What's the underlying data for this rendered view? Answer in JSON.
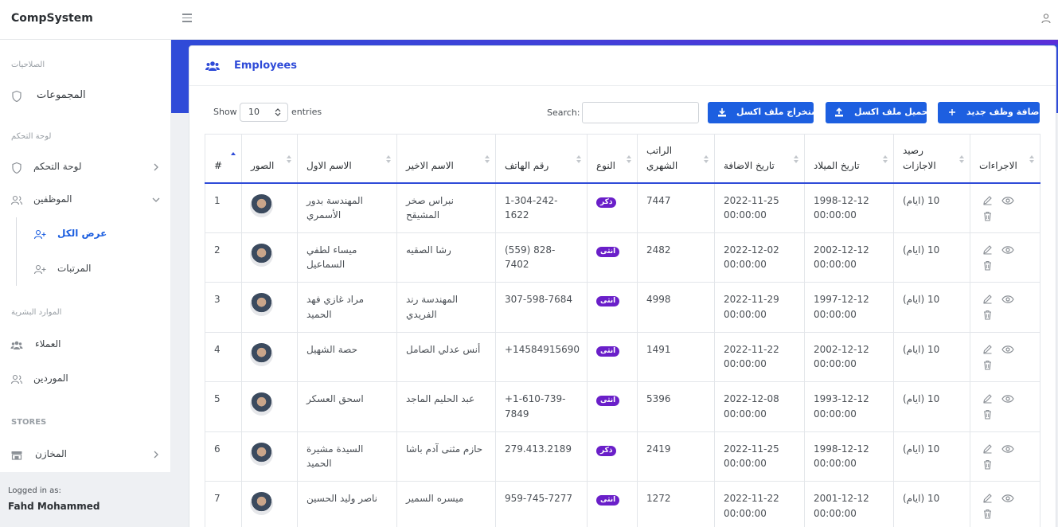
{
  "app": {
    "brand": "CompSystem"
  },
  "sidebar": {
    "sections": [
      {
        "title": "الصلاحيات"
      },
      {
        "title": "لوحة التحكم"
      },
      {
        "title": "الموارد البشرية"
      },
      {
        "title": "STORES"
      }
    ],
    "items": [
      {
        "label": "المجموعات",
        "icon": "shield-icon"
      },
      {
        "label": "لوحة التحكم",
        "icon": "shield-icon"
      },
      {
        "label": "الموظفين",
        "icon": "users-icon"
      },
      {
        "label": "عرض الكل",
        "icon": "user-plus-icon",
        "active": true
      },
      {
        "label": "المرتبات",
        "icon": "user-plus-icon"
      },
      {
        "label": "العملاء",
        "icon": "users-icon"
      },
      {
        "label": "الموردين",
        "icon": "users-icon"
      },
      {
        "label": "المخازن",
        "icon": "store-icon"
      }
    ],
    "footer": {
      "logged_in_label": "Logged in as:",
      "user_name": "Fahd Mohammed"
    }
  },
  "card": {
    "title": "Employees"
  },
  "table_controls": {
    "show_label": "Show",
    "page_length": "10",
    "entries_label": "entries",
    "search_label": "Search:",
    "search_value": ""
  },
  "buttons": {
    "add": "اضافة وظف جديد",
    "import": "تحميل ملف اكسل",
    "export": "استخراج ملف اكسل"
  },
  "table": {
    "columns": [
      {
        "lines": [
          "#"
        ]
      },
      {
        "lines": [
          "الصور"
        ]
      },
      {
        "lines": [
          "الاسم الاول"
        ]
      },
      {
        "lines": [
          "الاسم الاخير"
        ]
      },
      {
        "lines": [
          "رقم الهاتف"
        ]
      },
      {
        "lines": [
          "النوع"
        ]
      },
      {
        "lines": [
          "الراتب",
          "الشهري"
        ]
      },
      {
        "lines": [
          "تاريخ الاضافة"
        ]
      },
      {
        "lines": [
          "تاريخ الميلاد"
        ]
      },
      {
        "lines": [
          "رصيد",
          "الاجازات"
        ]
      },
      {
        "lines": [
          "الاجراءات"
        ]
      }
    ],
    "rows": [
      {
        "num": "1",
        "first": [
          "المهندسة بدور",
          "الأسمري"
        ],
        "last": [
          "نبراس صخر",
          "المشيقح"
        ],
        "phone": [
          "1-304-242-1622"
        ],
        "gender": "ذكر",
        "salary": "7447",
        "added": [
          "2022-11-25",
          "00:00:00"
        ],
        "birth": [
          "1998-12-12",
          "00:00:00"
        ],
        "leave": "10 (ايام)"
      },
      {
        "num": "2",
        "first": [
          "ميساء لطفي",
          "السماعيل"
        ],
        "last": [
          "رشا الصقيه"
        ],
        "phone": [
          "(559) 828-7402"
        ],
        "gender": "انثى",
        "salary": "2482",
        "added": [
          "2022-12-02",
          "00:00:00"
        ],
        "birth": [
          "2002-12-12",
          "00:00:00"
        ],
        "leave": "10 (ايام)"
      },
      {
        "num": "3",
        "first": [
          "مراد غازي فهد",
          "الحميد"
        ],
        "last": [
          "المهندسة رند",
          "الفريدي"
        ],
        "phone": [
          "307-598-7684"
        ],
        "gender": "انثى",
        "salary": "4998",
        "added": [
          "2022-11-29",
          "00:00:00"
        ],
        "birth": [
          "1997-12-12",
          "00:00:00"
        ],
        "leave": "10 (ايام)"
      },
      {
        "num": "4",
        "first": [
          "حصة الشهيل"
        ],
        "last": [
          "أنس عدلي الصامل"
        ],
        "phone": [
          "+14584915690"
        ],
        "gender": "انثى",
        "salary": "1491",
        "added": [
          "2022-11-22",
          "00:00:00"
        ],
        "birth": [
          "2002-12-12",
          "00:00:00"
        ],
        "leave": "10 (ايام)"
      },
      {
        "num": "5",
        "first": [
          "اسحق العسكر"
        ],
        "last": [
          "عبد الحليم الماجد"
        ],
        "phone": [
          "+1-610-739-",
          "7849"
        ],
        "gender": "انثى",
        "salary": "5396",
        "added": [
          "2022-12-08",
          "00:00:00"
        ],
        "birth": [
          "1993-12-12",
          "00:00:00"
        ],
        "leave": "10 (ايام)"
      },
      {
        "num": "6",
        "first": [
          "السيدة مشيرة",
          "الحميد"
        ],
        "last": [
          "حازم مثنى آدم باشا"
        ],
        "phone": [
          "279.413.2189"
        ],
        "gender": "ذكر",
        "salary": "2419",
        "added": [
          "2022-11-25",
          "00:00:00"
        ],
        "birth": [
          "1998-12-12",
          "00:00:00"
        ],
        "leave": "10 (ايام)"
      },
      {
        "num": "7",
        "first": [
          "ناصر وليد الحسين"
        ],
        "last": [
          "ميسره السمير"
        ],
        "phone": [
          "959-745-7277"
        ],
        "gender": "انثى",
        "salary": "1272",
        "added": [
          "2022-11-22",
          "00:00:00"
        ],
        "birth": [
          "2001-12-12",
          "00:00:00"
        ],
        "leave": "10 (ايام)"
      }
    ]
  },
  "colors": {
    "primary": "#1d5fe0",
    "header_band": "#2f4bd8",
    "badge": "#6a1fc9"
  }
}
